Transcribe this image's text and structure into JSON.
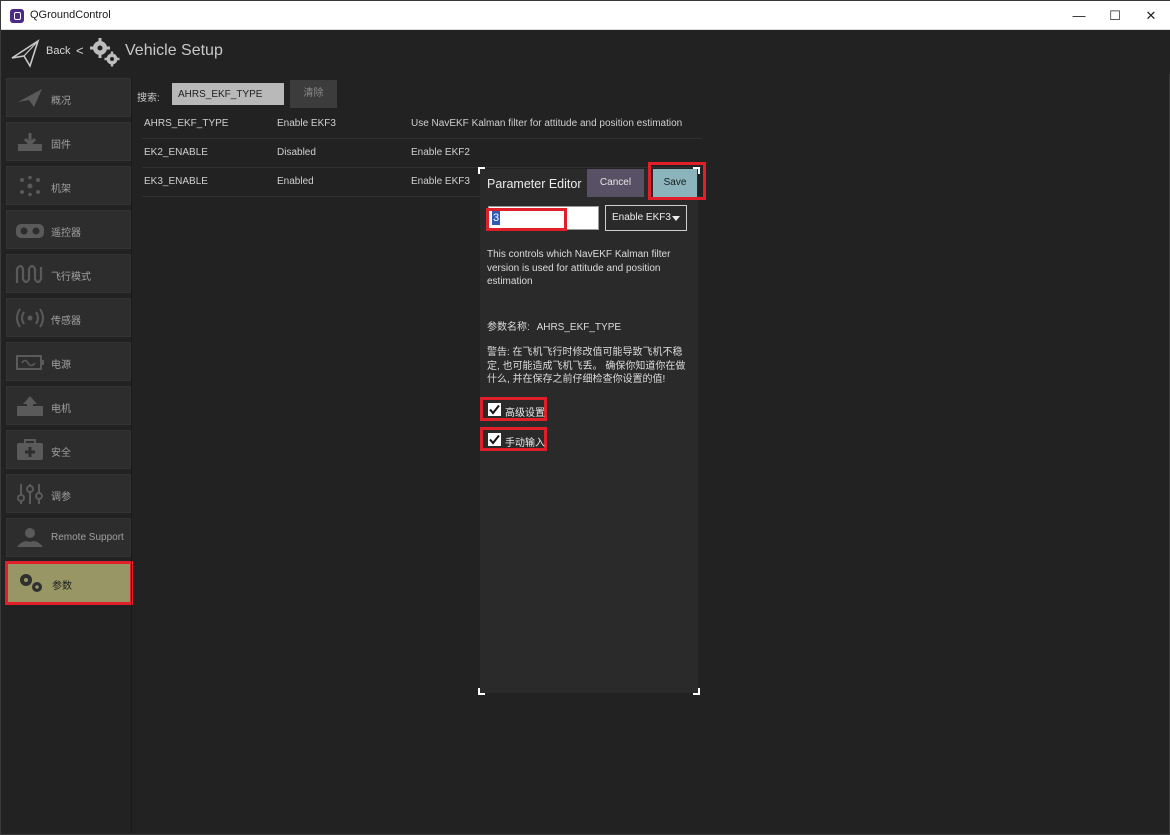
{
  "window": {
    "title": "QGroundControl",
    "controls": {
      "minimize": "—",
      "maximize": "☐",
      "close": "✕"
    }
  },
  "toolbar": {
    "back_label": "Back",
    "back_separator": "<",
    "page_title": "Vehicle Setup"
  },
  "sidebar": {
    "items": [
      {
        "label": "概况",
        "icon": "paper-plane-icon"
      },
      {
        "label": "固件",
        "icon": "download-icon"
      },
      {
        "label": "机架",
        "icon": "airframe-icon"
      },
      {
        "label": "遥控器",
        "icon": "radio-icon"
      },
      {
        "label": "飞行模式",
        "icon": "flight-modes-icon"
      },
      {
        "label": "传感器",
        "icon": "sensors-icon"
      },
      {
        "label": "电源",
        "icon": "power-icon"
      },
      {
        "label": "电机",
        "icon": "motor-icon"
      },
      {
        "label": "安全",
        "icon": "safety-icon"
      },
      {
        "label": "调参",
        "icon": "tuning-icon"
      },
      {
        "label": "Remote Support",
        "icon": "remote-support-icon"
      },
      {
        "label": "参数",
        "icon": "gears-icon",
        "active": true
      }
    ]
  },
  "search": {
    "label": "搜索:",
    "value": "AHRS_EKF_TYPE",
    "clear_label": "清除"
  },
  "params": [
    {
      "name": "AHRS_EKF_TYPE",
      "value": "Enable EKF3",
      "desc": "Use NavEKF Kalman filter for attitude and position estimation"
    },
    {
      "name": "EK2_ENABLE",
      "value": "Disabled",
      "desc": "Enable EKF2"
    },
    {
      "name": "EK3_ENABLE",
      "value": "Enabled",
      "desc": "Enable EKF3"
    }
  ],
  "editor": {
    "title": "Parameter Editor",
    "cancel_label": "Cancel",
    "save_label": "Save",
    "value": "3",
    "enum_selected": "Enable EKF3",
    "description": "This controls which NavEKF Kalman filter version is used for attitude and position estimation",
    "param_name_label": "参数名称:",
    "param_name": "AHRS_EKF_TYPE",
    "warning": "警告: 在飞机飞行时修改值可能导致飞机不稳定, 也可能造成飞机飞丢。 确保你知道你在做什么, 并在保存之前仔细检查你设置的值!",
    "advanced_label": "高级设置",
    "advanced_checked": true,
    "manual_label": "手动输入",
    "manual_checked": true
  },
  "colors": {
    "background": "#222222",
    "sidebar_item": "#2d2d2d",
    "active_item": "#989665",
    "highlight": "#e01f2a",
    "save_button": "#8bb4bd",
    "cancel_button": "#585165"
  }
}
